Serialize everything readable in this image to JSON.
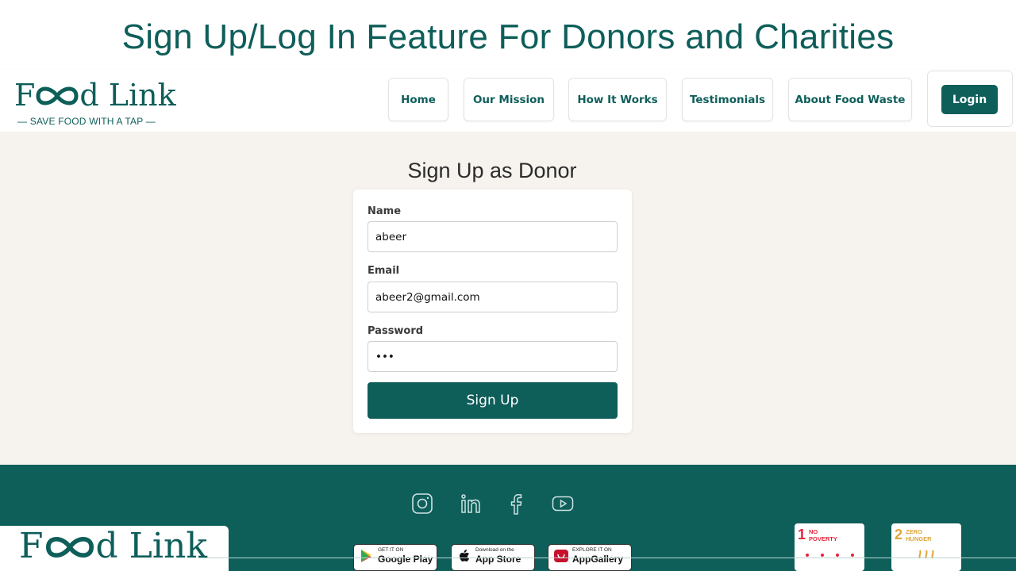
{
  "slide": {
    "title": "Sign Up/Log In Feature For Donors and Charities"
  },
  "logo": {
    "word_start": "F",
    "word_end": "d Link",
    "tagline": "— SAVE FOOD WITH A TAP —"
  },
  "nav": {
    "items": [
      {
        "label": "Home"
      },
      {
        "label": "Our Mission"
      },
      {
        "label": "How It Works"
      },
      {
        "label": "Testimonials"
      },
      {
        "label": "About Food Waste"
      }
    ],
    "login_label": "Login"
  },
  "form": {
    "title": "Sign Up as Donor",
    "name_label": "Name",
    "name_value": "abeer",
    "email_label": "Email",
    "email_value": "abeer2@gmail.com",
    "password_label": "Password",
    "password_value": "•••",
    "submit_label": "Sign Up"
  },
  "footer": {
    "social_icons": [
      "instagram-icon",
      "linkedin-icon",
      "facebook-icon",
      "youtube-icon"
    ],
    "logo_word_start": "F",
    "logo_word_end": "d Link",
    "stores": [
      {
        "small": "GET IT ON",
        "big": "Google Play"
      },
      {
        "small": "Download on the",
        "big": "App Store"
      },
      {
        "small": "EXPLORE IT ON",
        "big": "AppGallery"
      }
    ],
    "sdg": [
      {
        "num": "1",
        "text_line1": "NO",
        "text_line2": "POVERTY",
        "color": "#e5243b"
      },
      {
        "num": "2",
        "text_line1": "ZERO",
        "text_line2": "HUNGER",
        "color": "#dda63a"
      }
    ]
  },
  "colors": {
    "brand": "#0e5e5a",
    "background": "#f6f2ee"
  }
}
